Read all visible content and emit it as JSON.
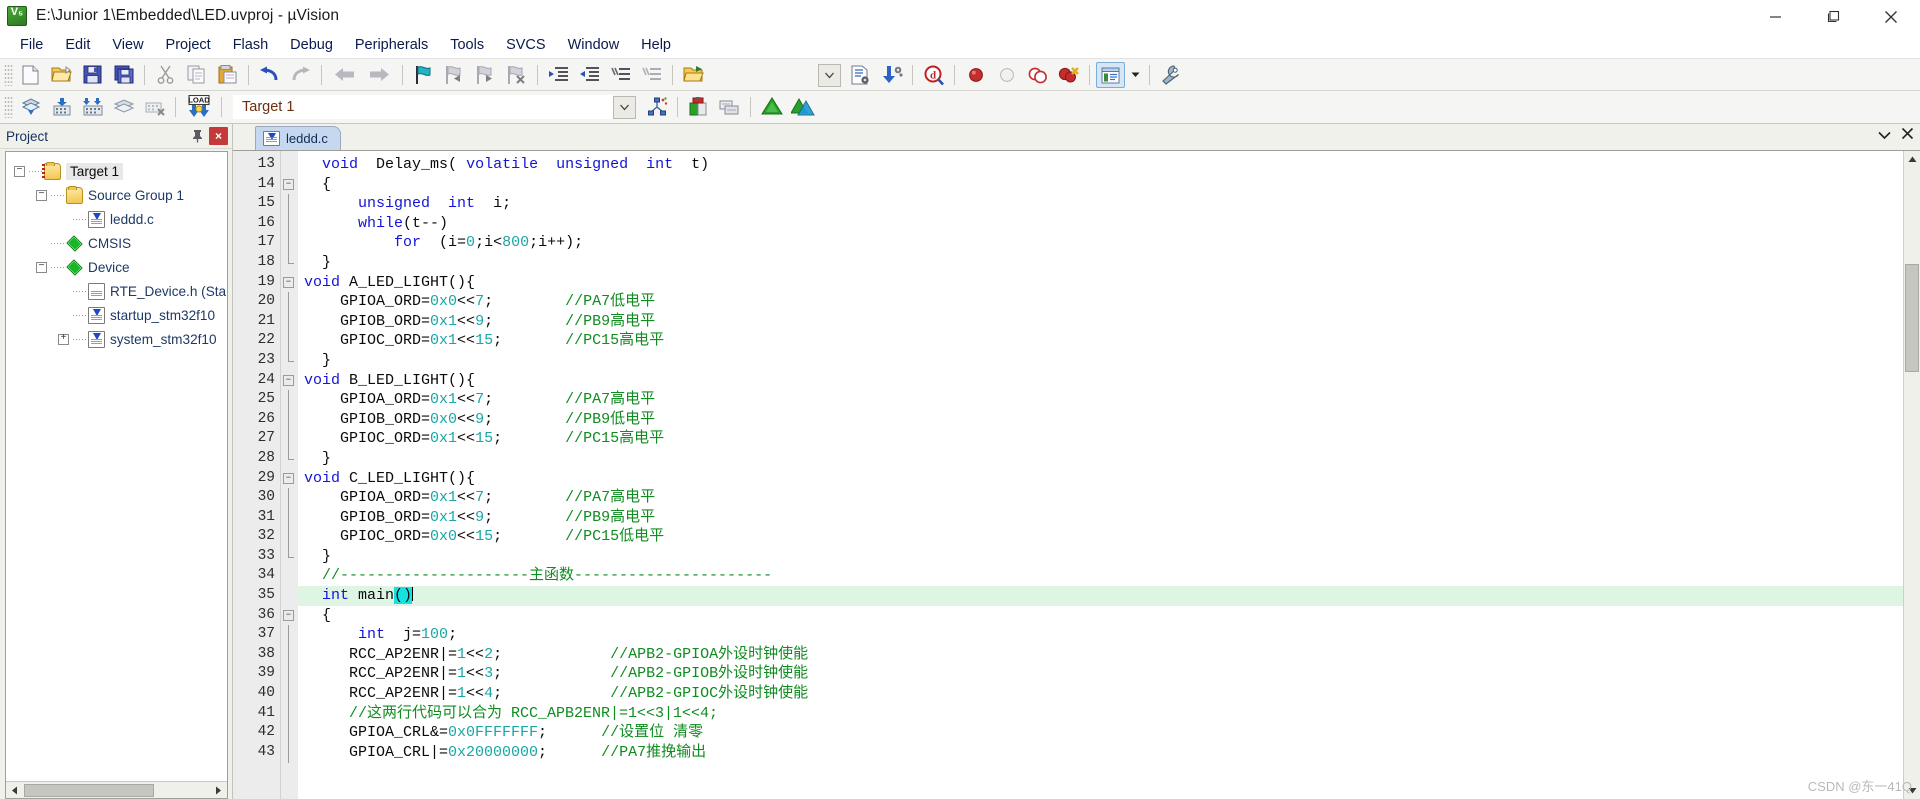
{
  "window": {
    "title": "E:\\Junior 1\\Embedded\\LED.uvproj - µVision",
    "app_icon": "uvision-icon",
    "minimize_label": "—",
    "maximize_label": "❐",
    "close_label": "✕"
  },
  "menu": {
    "items": [
      {
        "label": "File"
      },
      {
        "label": "Edit"
      },
      {
        "label": "View"
      },
      {
        "label": "Project"
      },
      {
        "label": "Flash"
      },
      {
        "label": "Debug"
      },
      {
        "label": "Peripherals"
      },
      {
        "label": "Tools"
      },
      {
        "label": "SVCS"
      },
      {
        "label": "Window"
      },
      {
        "label": "Help"
      }
    ]
  },
  "toolbar_main": {
    "icons": [
      "new-file-icon",
      "open-file-icon",
      "save-icon",
      "save-all-icon",
      "cut-icon",
      "copy-icon",
      "paste-icon",
      "undo-icon",
      "redo-icon",
      "navigate-back-icon",
      "navigate-forward-icon",
      "bookmark-toggle-icon",
      "bookmark-prev-icon",
      "bookmark-next-icon",
      "bookmark-clear-icon",
      "indent-icon",
      "outdent-icon",
      "comment-icon",
      "uncomment-icon",
      "open-folder-icon"
    ],
    "right_icons": [
      "dropdown-arrow-icon",
      "configuration-wizard-icon",
      "debug-settings-icon",
      "start-debug-icon",
      "insert-breakpoint-icon",
      "disable-breakpoint-icon",
      "disable-all-breakpoints-icon",
      "kill-all-breakpoints-icon",
      "project-window-icon",
      "dropdown-small-icon",
      "options-wrench-icon"
    ]
  },
  "toolbar_build": {
    "icons": [
      "translate-icon",
      "build-icon",
      "rebuild-all-icon",
      "batch-build-icon",
      "stop-build-icon",
      "load-icon"
    ],
    "load_label": "LOAD",
    "target_value": "Target 1",
    "target_placeholder": "Target 1",
    "right_icons": [
      "combo-arrow-icon",
      "manage-runtime-icon",
      "manage-project-items-icon",
      "multi-project-icon",
      "pack-installer-icon",
      "pack-installer-2-icon"
    ]
  },
  "project_panel": {
    "title": "Project",
    "pin_icon": "pin-icon",
    "close_icon": "close-icon",
    "tree": [
      {
        "label": "Target 1",
        "icon": "project-target-icon",
        "toggle": "minus",
        "depth": 0,
        "selected": true
      },
      {
        "label": "Source Group 1",
        "icon": "folder-icon",
        "toggle": "minus",
        "depth": 1,
        "selected": false
      },
      {
        "label": "leddd.c",
        "icon": "c-file-icon",
        "toggle": "none",
        "depth": 2,
        "selected": false
      },
      {
        "label": "CMSIS",
        "icon": "component-icon",
        "toggle": "none",
        "depth": 1,
        "selected": false
      },
      {
        "label": "Device",
        "icon": "component-icon",
        "toggle": "minus",
        "depth": 1,
        "selected": false
      },
      {
        "label": "RTE_Device.h (Sta",
        "icon": "h-file-icon",
        "toggle": "none",
        "depth": 2,
        "selected": false
      },
      {
        "label": "startup_stm32f10",
        "icon": "c-file-icon",
        "toggle": "none",
        "depth": 2,
        "selected": false
      },
      {
        "label": "system_stm32f10",
        "icon": "c-file-icon",
        "toggle": "plus",
        "depth": 2,
        "selected": false
      }
    ],
    "scroll_left_icon": "scroll-left-icon",
    "scroll_right_icon": "scroll-right-icon"
  },
  "editor": {
    "tabs": [
      {
        "label": "leddd.c",
        "icon": "c-file-icon",
        "active": true
      }
    ],
    "tab_dropdown_icon": "chevron-down-icon",
    "tab_close_icon": "close-icon",
    "scroll_up_icon": "scroll-up-icon",
    "scroll_down_icon": "scroll-down-icon",
    "first_line": 13,
    "lines": [
      {
        "n": 13,
        "fold": "none",
        "tokens": [
          {
            "t": "  ",
            "c": ""
          },
          {
            "t": "void",
            "c": "kw"
          },
          {
            "t": "  Delay_ms( ",
            "c": ""
          },
          {
            "t": "volatile",
            "c": "kw"
          },
          {
            "t": "  ",
            "c": ""
          },
          {
            "t": "unsigned",
            "c": "kw"
          },
          {
            "t": "  ",
            "c": ""
          },
          {
            "t": "int",
            "c": "kw"
          },
          {
            "t": "  t)",
            "c": ""
          }
        ]
      },
      {
        "n": 14,
        "fold": "start",
        "tokens": [
          {
            "t": "  {",
            "c": ""
          }
        ]
      },
      {
        "n": 15,
        "fold": "body",
        "tokens": [
          {
            "t": "      ",
            "c": ""
          },
          {
            "t": "unsigned",
            "c": "kw"
          },
          {
            "t": "  ",
            "c": ""
          },
          {
            "t": "int",
            "c": "kw"
          },
          {
            "t": "  i;",
            "c": ""
          }
        ]
      },
      {
        "n": 16,
        "fold": "body",
        "tokens": [
          {
            "t": "      ",
            "c": ""
          },
          {
            "t": "while",
            "c": "kw"
          },
          {
            "t": "(t--)",
            "c": ""
          }
        ]
      },
      {
        "n": 17,
        "fold": "body",
        "tokens": [
          {
            "t": "          ",
            "c": ""
          },
          {
            "t": "for",
            "c": "kw"
          },
          {
            "t": "  (i=",
            "c": ""
          },
          {
            "t": "0",
            "c": "num"
          },
          {
            "t": ";i<",
            "c": ""
          },
          {
            "t": "800",
            "c": "num"
          },
          {
            "t": ";i++);",
            "c": ""
          }
        ]
      },
      {
        "n": 18,
        "fold": "end",
        "tokens": [
          {
            "t": "  }",
            "c": ""
          }
        ]
      },
      {
        "n": 19,
        "fold": "start",
        "tokens": [
          {
            "t": "void",
            "c": "kw"
          },
          {
            "t": " A_LED_LIGHT(){",
            "c": ""
          }
        ]
      },
      {
        "n": 20,
        "fold": "body",
        "tokens": [
          {
            "t": "    GPIOA_ORD=",
            "c": ""
          },
          {
            "t": "0x0",
            "c": "num"
          },
          {
            "t": "<<",
            "c": ""
          },
          {
            "t": "7",
            "c": "num"
          },
          {
            "t": ";        ",
            "c": ""
          },
          {
            "t": "//PA7低电平",
            "c": "cmt"
          }
        ]
      },
      {
        "n": 21,
        "fold": "body",
        "tokens": [
          {
            "t": "    GPIOB_ORD=",
            "c": ""
          },
          {
            "t": "0x1",
            "c": "num"
          },
          {
            "t": "<<",
            "c": ""
          },
          {
            "t": "9",
            "c": "num"
          },
          {
            "t": ";        ",
            "c": ""
          },
          {
            "t": "//PB9高电平",
            "c": "cmt"
          }
        ]
      },
      {
        "n": 22,
        "fold": "body",
        "tokens": [
          {
            "t": "    GPIOC_ORD=",
            "c": ""
          },
          {
            "t": "0x1",
            "c": "num"
          },
          {
            "t": "<<",
            "c": ""
          },
          {
            "t": "15",
            "c": "num"
          },
          {
            "t": ";       ",
            "c": ""
          },
          {
            "t": "//PC15高电平",
            "c": "cmt"
          }
        ]
      },
      {
        "n": 23,
        "fold": "end",
        "tokens": [
          {
            "t": "  }",
            "c": ""
          }
        ]
      },
      {
        "n": 24,
        "fold": "start",
        "tokens": [
          {
            "t": "void",
            "c": "kw"
          },
          {
            "t": " B_LED_LIGHT(){",
            "c": ""
          }
        ]
      },
      {
        "n": 25,
        "fold": "body",
        "tokens": [
          {
            "t": "    GPIOA_ORD=",
            "c": ""
          },
          {
            "t": "0x1",
            "c": "num"
          },
          {
            "t": "<<",
            "c": ""
          },
          {
            "t": "7",
            "c": "num"
          },
          {
            "t": ";        ",
            "c": ""
          },
          {
            "t": "//PA7高电平",
            "c": "cmt"
          }
        ]
      },
      {
        "n": 26,
        "fold": "body",
        "tokens": [
          {
            "t": "    GPIOB_ORD=",
            "c": ""
          },
          {
            "t": "0x0",
            "c": "num"
          },
          {
            "t": "<<",
            "c": ""
          },
          {
            "t": "9",
            "c": "num"
          },
          {
            "t": ";        ",
            "c": ""
          },
          {
            "t": "//PB9低电平",
            "c": "cmt"
          }
        ]
      },
      {
        "n": 27,
        "fold": "body",
        "tokens": [
          {
            "t": "    GPIOC_ORD=",
            "c": ""
          },
          {
            "t": "0x1",
            "c": "num"
          },
          {
            "t": "<<",
            "c": ""
          },
          {
            "t": "15",
            "c": "num"
          },
          {
            "t": ";       ",
            "c": ""
          },
          {
            "t": "//PC15高电平",
            "c": "cmt"
          }
        ]
      },
      {
        "n": 28,
        "fold": "end",
        "tokens": [
          {
            "t": "  }",
            "c": ""
          }
        ]
      },
      {
        "n": 29,
        "fold": "start",
        "tokens": [
          {
            "t": "void",
            "c": "kw"
          },
          {
            "t": " C_LED_LIGHT(){",
            "c": ""
          }
        ]
      },
      {
        "n": 30,
        "fold": "body",
        "tokens": [
          {
            "t": "    GPIOA_ORD=",
            "c": ""
          },
          {
            "t": "0x1",
            "c": "num"
          },
          {
            "t": "<<",
            "c": ""
          },
          {
            "t": "7",
            "c": "num"
          },
          {
            "t": ";        ",
            "c": ""
          },
          {
            "t": "//PA7高电平",
            "c": "cmt"
          }
        ]
      },
      {
        "n": 31,
        "fold": "body",
        "tokens": [
          {
            "t": "    GPIOB_ORD=",
            "c": ""
          },
          {
            "t": "0x1",
            "c": "num"
          },
          {
            "t": "<<",
            "c": ""
          },
          {
            "t": "9",
            "c": "num"
          },
          {
            "t": ";        ",
            "c": ""
          },
          {
            "t": "//PB9高电平",
            "c": "cmt"
          }
        ]
      },
      {
        "n": 32,
        "fold": "body",
        "tokens": [
          {
            "t": "    GPIOC_ORD=",
            "c": ""
          },
          {
            "t": "0x0",
            "c": "num"
          },
          {
            "t": "<<",
            "c": ""
          },
          {
            "t": "15",
            "c": "num"
          },
          {
            "t": ";       ",
            "c": ""
          },
          {
            "t": "//PC15低电平",
            "c": "cmt"
          }
        ]
      },
      {
        "n": 33,
        "fold": "end",
        "tokens": [
          {
            "t": "  }",
            "c": ""
          }
        ]
      },
      {
        "n": 34,
        "fold": "none",
        "tokens": [
          {
            "t": "  //---------------------主函数----------------------",
            "c": "cmt"
          }
        ]
      },
      {
        "n": 35,
        "fold": "none",
        "highlight": true,
        "tokens": [
          {
            "t": "  ",
            "c": ""
          },
          {
            "t": "int",
            "c": "kw"
          },
          {
            "t": " main",
            "c": ""
          },
          {
            "t": "()",
            "c": "sel"
          },
          {
            "t": "",
            "c": "caret"
          }
        ]
      },
      {
        "n": 36,
        "fold": "start",
        "tokens": [
          {
            "t": "  {",
            "c": ""
          }
        ]
      },
      {
        "n": 37,
        "fold": "body",
        "tokens": [
          {
            "t": "      ",
            "c": ""
          },
          {
            "t": "int",
            "c": "kw"
          },
          {
            "t": "  j=",
            "c": ""
          },
          {
            "t": "100",
            "c": "num"
          },
          {
            "t": ";",
            "c": ""
          }
        ]
      },
      {
        "n": 38,
        "fold": "body",
        "tokens": [
          {
            "t": "     RCC_AP2ENR|=",
            "c": ""
          },
          {
            "t": "1",
            "c": "num"
          },
          {
            "t": "<<",
            "c": ""
          },
          {
            "t": "2",
            "c": "num"
          },
          {
            "t": ";            ",
            "c": ""
          },
          {
            "t": "//APB2-GPIOA外设时钟使能",
            "c": "cmt"
          }
        ]
      },
      {
        "n": 39,
        "fold": "body",
        "tokens": [
          {
            "t": "     RCC_AP2ENR|=",
            "c": ""
          },
          {
            "t": "1",
            "c": "num"
          },
          {
            "t": "<<",
            "c": ""
          },
          {
            "t": "3",
            "c": "num"
          },
          {
            "t": ";            ",
            "c": ""
          },
          {
            "t": "//APB2-GPIOB外设时钟使能",
            "c": "cmt"
          }
        ]
      },
      {
        "n": 40,
        "fold": "body",
        "tokens": [
          {
            "t": "     RCC_AP2ENR|=",
            "c": ""
          },
          {
            "t": "1",
            "c": "num"
          },
          {
            "t": "<<",
            "c": ""
          },
          {
            "t": "4",
            "c": "num"
          },
          {
            "t": ";            ",
            "c": ""
          },
          {
            "t": "//APB2-GPIOC外设时钟使能",
            "c": "cmt"
          }
        ]
      },
      {
        "n": 41,
        "fold": "body",
        "tokens": [
          {
            "t": "     //这两行代码可以合为 RCC_APB2ENR|=1<<3|1<<4;",
            "c": "cmt"
          }
        ]
      },
      {
        "n": 42,
        "fold": "body",
        "tokens": [
          {
            "t": "     GPIOA_CRL&=",
            "c": ""
          },
          {
            "t": "0x0FFFFFFF",
            "c": "num"
          },
          {
            "t": ";      ",
            "c": ""
          },
          {
            "t": "//设置位 清零",
            "c": "cmt"
          }
        ]
      },
      {
        "n": 43,
        "fold": "body",
        "tokens": [
          {
            "t": "     GPIOA_CRL|=",
            "c": ""
          },
          {
            "t": "0x20000000",
            "c": "num"
          },
          {
            "t": ";      ",
            "c": ""
          },
          {
            "t": "//PA7推挽输出",
            "c": "cmt"
          }
        ]
      }
    ]
  },
  "watermark": {
    "text": "CSDN @东一41Q"
  },
  "colors": {
    "keyword": "#1414d6",
    "number": "#1aa6a6",
    "comment": "#108c20",
    "selection": "#16e0e0",
    "current_line": "#ddf5e2",
    "title_link": "#1d3a66",
    "close_button": "#c43a3a"
  }
}
